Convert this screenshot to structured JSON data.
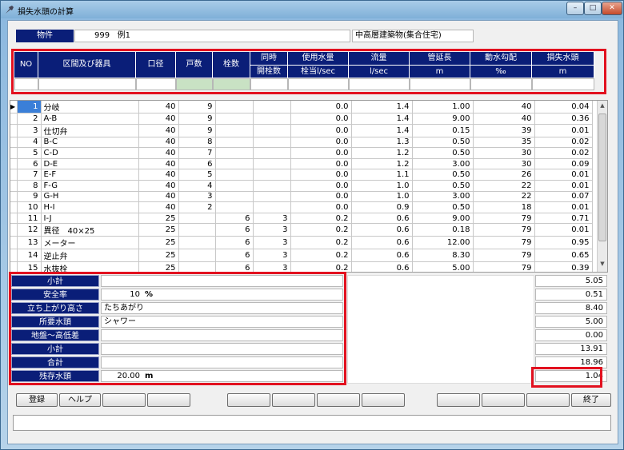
{
  "window": {
    "title": "損失水頭の計算"
  },
  "property": {
    "label": "物件",
    "code": "999",
    "name": "例1",
    "building_type": "中高層建築物(集合住宅)"
  },
  "header": {
    "columns": [
      {
        "top": "NO",
        "bottom": ""
      },
      {
        "top": "区間及び器具",
        "bottom": ""
      },
      {
        "top": "口径",
        "bottom": ""
      },
      {
        "top": "戸数",
        "bottom": ""
      },
      {
        "top": "栓数",
        "bottom": ""
      },
      {
        "top": "同時",
        "bottom": "開栓数"
      },
      {
        "top": "使用水量",
        "bottom": "栓当l/sec"
      },
      {
        "top": "流量",
        "bottom": "l/sec"
      },
      {
        "top": "管延長",
        "bottom": "m"
      },
      {
        "top": "動水勾配",
        "bottom": "‰"
      },
      {
        "top": "損失水頭",
        "bottom": "m"
      }
    ]
  },
  "rows": [
    [
      "1",
      "分岐",
      "40",
      "9",
      "",
      "",
      "0.0",
      "1.4",
      "1.00",
      "40",
      "0.04"
    ],
    [
      "2",
      "A-B",
      "40",
      "9",
      "",
      "",
      "0.0",
      "1.4",
      "9.00",
      "40",
      "0.36"
    ],
    [
      "3",
      "仕切弁",
      "40",
      "9",
      "",
      "",
      "0.0",
      "1.4",
      "0.15",
      "39",
      "0.01"
    ],
    [
      "4",
      "B-C",
      "40",
      "8",
      "",
      "",
      "0.0",
      "1.3",
      "0.50",
      "35",
      "0.02"
    ],
    [
      "5",
      "C-D",
      "40",
      "7",
      "",
      "",
      "0.0",
      "1.2",
      "0.50",
      "30",
      "0.02"
    ],
    [
      "6",
      "D-E",
      "40",
      "6",
      "",
      "",
      "0.0",
      "1.2",
      "3.00",
      "30",
      "0.09"
    ],
    [
      "7",
      "E-F",
      "40",
      "5",
      "",
      "",
      "0.0",
      "1.1",
      "0.50",
      "26",
      "0.01"
    ],
    [
      "8",
      "F-G",
      "40",
      "4",
      "",
      "",
      "0.0",
      "1.0",
      "0.50",
      "22",
      "0.01"
    ],
    [
      "9",
      "G-H",
      "40",
      "3",
      "",
      "",
      "0.0",
      "1.0",
      "3.00",
      "22",
      "0.07"
    ],
    [
      "10",
      "H-I",
      "40",
      "2",
      "",
      "",
      "0.0",
      "0.9",
      "0.50",
      "18",
      "0.01"
    ],
    [
      "11",
      "I-J",
      "25",
      "",
      "6",
      "3",
      "0.2",
      "0.6",
      "9.00",
      "79",
      "0.71"
    ],
    [
      "12",
      "異径　40×25",
      "25",
      "",
      "6",
      "3",
      "0.2",
      "0.6",
      "0.18",
      "79",
      "0.01"
    ],
    [
      "13",
      "メーター",
      "25",
      "",
      "6",
      "3",
      "0.2",
      "0.6",
      "12.00",
      "79",
      "0.95"
    ],
    [
      "14",
      "逆止弁",
      "25",
      "",
      "6",
      "3",
      "0.2",
      "0.6",
      "8.30",
      "79",
      "0.65"
    ],
    [
      "15",
      "水抜栓",
      "25",
      "",
      "6",
      "3",
      "0.2",
      "0.6",
      "5.00",
      "79",
      "0.39"
    ]
  ],
  "summary": {
    "subtotal1": {
      "label": "小計",
      "text": "",
      "value": "5.05"
    },
    "safety": {
      "label": "安全率",
      "text": "10",
      "unit": "%",
      "value": "0.51"
    },
    "riser": {
      "label": "立ち上がり高さ",
      "text": "たちあがり",
      "value": "8.40"
    },
    "required": {
      "label": "所要水頭",
      "text": "シャワー",
      "value": "5.00"
    },
    "ground": {
      "label": "地盤〜高低差",
      "text": "",
      "value": "0.00"
    },
    "subtotal2": {
      "label": "小計",
      "text": "",
      "value": "13.91"
    },
    "total": {
      "label": "合計",
      "text": "",
      "value": "18.96"
    },
    "residual": {
      "label": "残存水頭",
      "text": "20.00",
      "unit": "m",
      "value": "1.04"
    }
  },
  "buttons": {
    "register": "登録",
    "help": "ヘルプ",
    "exit": "終了"
  }
}
